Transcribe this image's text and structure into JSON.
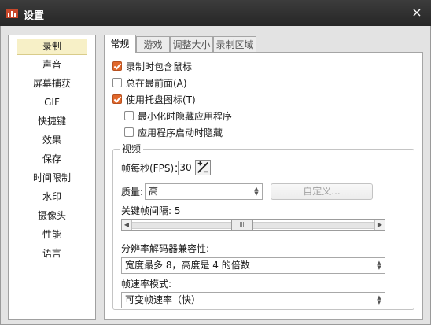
{
  "window": {
    "title": "设置",
    "close_glyph": "×"
  },
  "sidebar": {
    "items": [
      {
        "label": "录制",
        "active": true
      },
      {
        "label": "声音"
      },
      {
        "label": "屏幕捕获"
      },
      {
        "label": "GIF"
      },
      {
        "label": "快捷键"
      },
      {
        "label": "效果"
      },
      {
        "label": "保存"
      },
      {
        "label": "时间限制"
      },
      {
        "label": "水印"
      },
      {
        "label": "摄像头"
      },
      {
        "label": "性能"
      },
      {
        "label": "语言"
      }
    ]
  },
  "tabs": [
    {
      "label": "常规",
      "active": true
    },
    {
      "label": "游戏"
    },
    {
      "label": "调整大小"
    },
    {
      "label": "录制区域"
    }
  ],
  "general": {
    "include_cursor": {
      "label": "录制时包含鼠标",
      "checked": true
    },
    "always_on_top": {
      "label": "总在最前面(A)",
      "checked": false
    },
    "tray_icon": {
      "label": "使用托盘图标(T)",
      "checked": true
    },
    "hide_on_minimize": {
      "label": "最小化时隐藏应用程序",
      "checked": false
    },
    "hide_on_start": {
      "label": "应用程序启动时隐藏",
      "checked": false
    }
  },
  "video": {
    "group_title": "视频",
    "fps_label": "帧每秒(FPS)：",
    "fps_value": "30",
    "quality_label": "质量:",
    "quality_value": "高",
    "custom_button": "自定义...",
    "keyframe_label": "关键帧间隔: 5",
    "keyframe_slider_position": 0.45,
    "resolution_label": "分辨率解码器兼容性:",
    "resolution_value": "宽度最多 8，高度是 4 的倍数",
    "framerate_mode_label": "帧速率模式:",
    "framerate_mode_value": "可变帧速率（快）"
  },
  "colors": {
    "accent_checkbox": "#e0672b",
    "titlebar": "#2e2e2e",
    "selected_item": "#f7f0c7"
  }
}
